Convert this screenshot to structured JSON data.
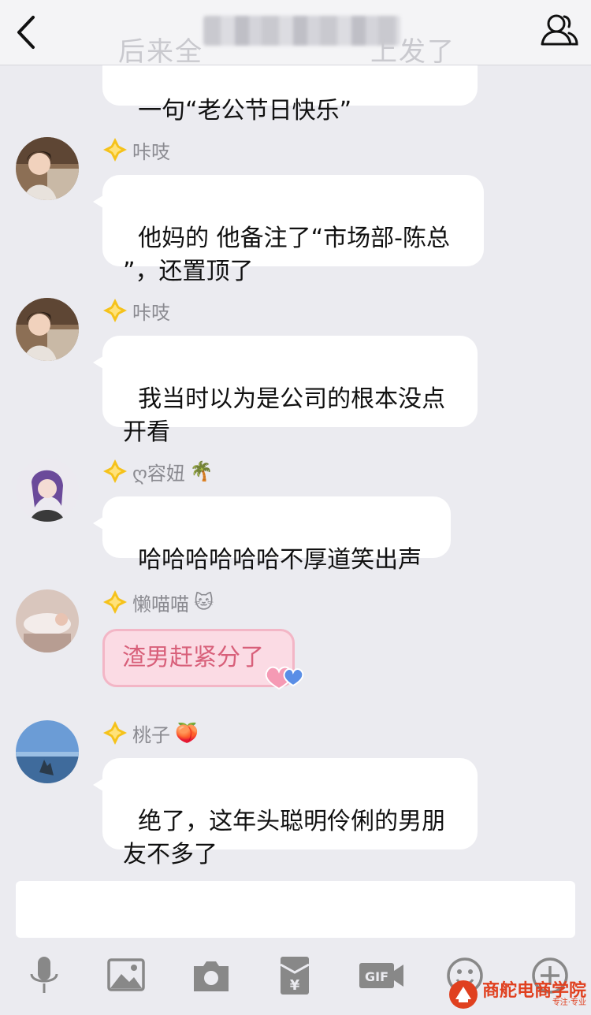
{
  "header": {
    "title_ghost": "后来全",
    "ghost_tail": "上发了"
  },
  "messages": [
    {
      "text": "一句“老公节日快乐”"
    },
    {
      "sender": "咔吱",
      "text": "他妈的 他备注了“市场部-陈总\n”，还置顶了"
    },
    {
      "sender": "咔吱",
      "text": "我当时以为是公司的根本没点\n开看"
    },
    {
      "sender": "ღ容妞",
      "emoji": "🌴",
      "text": "哈哈哈哈哈哈不厚道笑出声"
    },
    {
      "sender": "懒喵喵",
      "emoji": "🐱",
      "text": "渣男赶紧分了"
    },
    {
      "sender": "桃子",
      "emoji": "🍑",
      "text": "绝了，这年头聪明伶俐的男朋\n友不多了"
    }
  ],
  "toolbar": {
    "gif_label": "GIF",
    "yuan": "¥"
  },
  "watermark": {
    "text": "商舵电商学院",
    "sub": "专注·专业"
  },
  "colors": {
    "background": "#ebebf0",
    "pink_bubble": "#fbdbe4",
    "pink_text": "#d8607a",
    "diamond": "#f5c21b"
  }
}
